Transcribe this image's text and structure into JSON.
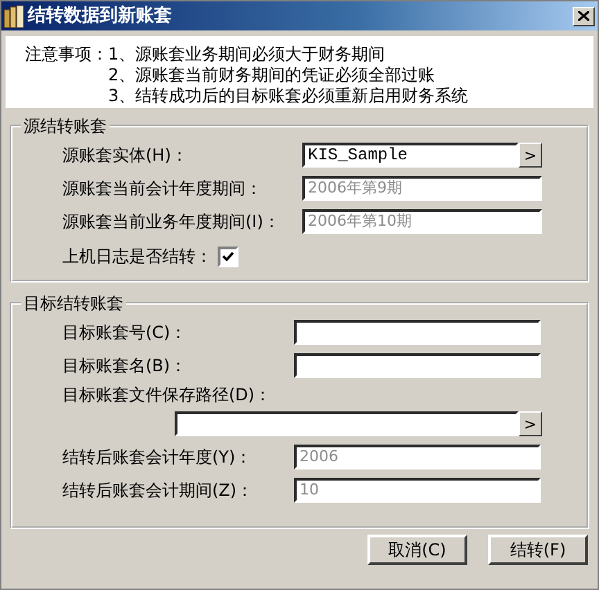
{
  "window": {
    "title": "结转数据到新账套"
  },
  "notice": {
    "heading": "注意事项：",
    "items": [
      "1、源账套业务期间必须大于财务期间",
      "2、源账套当前财务期间的凭证必须全部过账",
      "3、结转成功后的目标账套必须重新启用财务系统"
    ]
  },
  "groups": [
    {
      "title": "源结转账套",
      "rows": [
        {
          "kind": "browse",
          "label": "源账套实体(H)：",
          "value": "KIS_Sample"
        },
        {
          "kind": "field",
          "label": "源账套当前会计年度期间：",
          "value": "2006年第9期",
          "disabled": true
        },
        {
          "kind": "field",
          "label": "源账套当前业务年度期间(I)：",
          "value": "2006年第10期",
          "disabled": true
        },
        {
          "kind": "checkbox",
          "label": "上机日志是否结转：",
          "checked": true
        }
      ]
    },
    {
      "title": "目标结转账套",
      "rows": [
        {
          "kind": "field",
          "label": "目标账套号(C)："
        },
        {
          "kind": "field",
          "label": "目标账套名(B)："
        },
        {
          "kind": "path",
          "label": "目标账套文件保存路径(D)："
        },
        {
          "kind": "field",
          "label": "结转后账套会计年度(Y)：",
          "value": "2006",
          "disabled": true
        },
        {
          "kind": "field",
          "label": "结转后账套会计期间(Z)：",
          "value": "10",
          "disabled": true
        }
      ]
    }
  ],
  "buttons": [
    "取消(C)",
    "结转(F)"
  ],
  "browse_glyph": ">"
}
